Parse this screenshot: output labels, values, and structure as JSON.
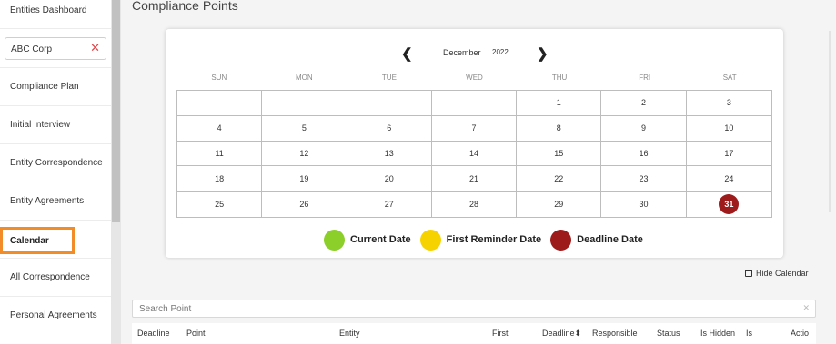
{
  "sidebar": {
    "items": [
      {
        "label": "Entities Dashboard"
      },
      {
        "label": "Compliance Plan"
      },
      {
        "label": "Initial Interview"
      },
      {
        "label": "Entity Correspondence"
      },
      {
        "label": "Entity Agreements"
      },
      {
        "label": "Calendar"
      },
      {
        "label": "All Correspondence"
      },
      {
        "label": "Personal Agreements"
      }
    ],
    "entity_filter": {
      "value": "ABC Corp",
      "clear_icon": "close-icon"
    }
  },
  "main": {
    "title": "Compliance Points",
    "calendar": {
      "month": "December",
      "year": "2022",
      "weekdays": [
        "SUN",
        "MON",
        "TUE",
        "WED",
        "THU",
        "FRI",
        "SAT"
      ],
      "days": [
        "",
        "",
        "",
        "",
        "1",
        "2",
        "3",
        "4",
        "5",
        "6",
        "7",
        "8",
        "9",
        "10",
        "11",
        "12",
        "13",
        "14",
        "15",
        "16",
        "17",
        "18",
        "19",
        "20",
        "21",
        "22",
        "23",
        "24",
        "25",
        "26",
        "27",
        "28",
        "29",
        "30",
        "31"
      ],
      "deadline_days": [
        "31"
      ]
    },
    "legend": [
      {
        "label": "Current Date",
        "color": "#8ccf2a"
      },
      {
        "label": "First Reminder Date",
        "color": "#f6d300"
      },
      {
        "label": "Deadline Date",
        "color": "#9e1b1b"
      }
    ],
    "hide_calendar_label": "Hide Calendar",
    "search": {
      "placeholder": "Search Point"
    },
    "table_headers": [
      "Deadline",
      "Point",
      "Entity",
      "First",
      "Deadline",
      "Responsible",
      "Status",
      "Is Hidden",
      "Is",
      "Actio"
    ]
  }
}
